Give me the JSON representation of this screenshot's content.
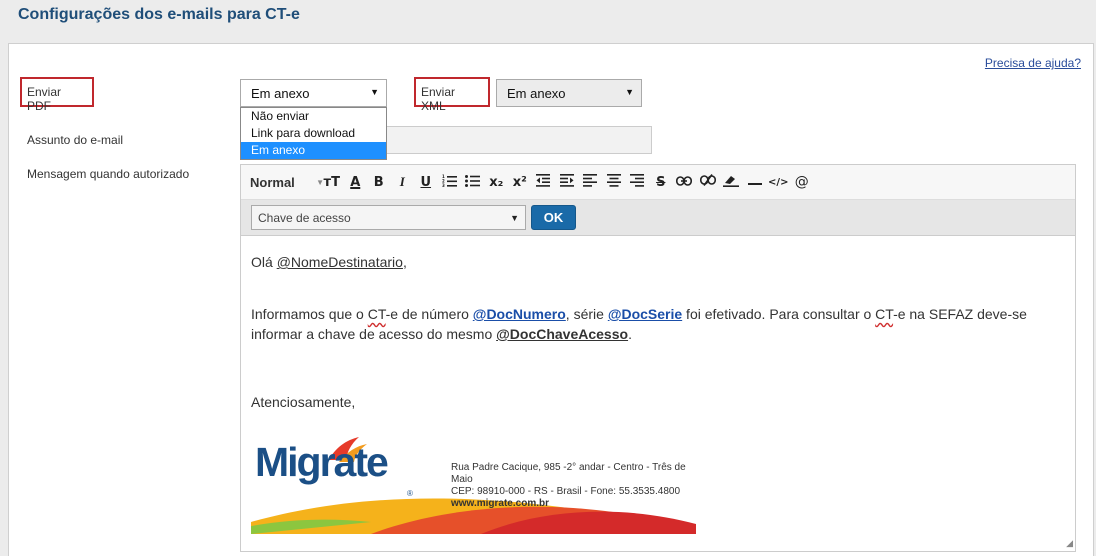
{
  "page": {
    "title": "Configurações dos e-mails para CT-e"
  },
  "help_link": "Precisa de ajuda?",
  "fields": {
    "pdf_label": "Enviar PDF",
    "pdf_value": "Em anexo",
    "pdf_options": [
      "Não enviar",
      "Link para download",
      "Em anexo"
    ],
    "xml_label": "Enviar XML",
    "xml_value": "Em anexo",
    "subject_label": "Assunto do e-mail",
    "message_label": "Mensagem quando autorizado"
  },
  "toolbar": {
    "format": "Normal",
    "icons": [
      "font-size-icon",
      "font-color-icon",
      "bold-icon",
      "italic-icon",
      "underline-icon",
      "ordered-list-icon",
      "bullet-list-icon",
      "subscript-icon",
      "superscript-icon",
      "outdent-icon",
      "indent-icon",
      "align-left-icon",
      "align-center-icon",
      "align-right-icon",
      "strikethrough-icon",
      "link-icon",
      "unlink-icon",
      "clear-format-icon",
      "horizontal-rule-icon",
      "code-icon",
      "mention-icon"
    ],
    "labels": {
      "font_size": "тT",
      "font_color": "A",
      "bold": "B",
      "italic": "I",
      "underline": "U",
      "subscript": "x₂",
      "superscript": "x²",
      "strike": "S",
      "code": "</>",
      "mention": "@"
    }
  },
  "variable": {
    "value": "Chave de acesso",
    "ok_label": "OK"
  },
  "message": {
    "greeting_pre": "Olá ",
    "greeting_var": "@NomeDestinatario",
    "greeting_post": ",",
    "p1_a": "Informamos que o ",
    "p1_ct1": "CT",
    "p1_b": "-e de número ",
    "p1_var1": "@DocNumero",
    "p1_c": ", série ",
    "p1_var2": "@DocSerie",
    "p1_d": " foi efetivado. Para consultar o ",
    "p1_ct2": "CT",
    "p1_e": "-e na SEFAZ deve-se",
    "p2_a": "informar a chave de acesso do mesmo ",
    "p2_var": "@DocChaveAcesso",
    "p2_b": ".",
    "closing": "Atenciosamente,"
  },
  "signature": {
    "brand": "Migrate",
    "reg": "®",
    "address1": "Rua Padre Cacique, 985 -2° andar - Centro - Três de Maio",
    "address2": "CEP: 98910-000 - RS - Brasil - Fone: 55.3535.4800",
    "url": "www.migrate.com.br"
  },
  "colors": {
    "title": "#1f4e79",
    "highlight_border": "#c0282d",
    "ok_button": "#1a6aa8",
    "variable": "#1a4ea8",
    "selected_option": "#1e90ff"
  }
}
